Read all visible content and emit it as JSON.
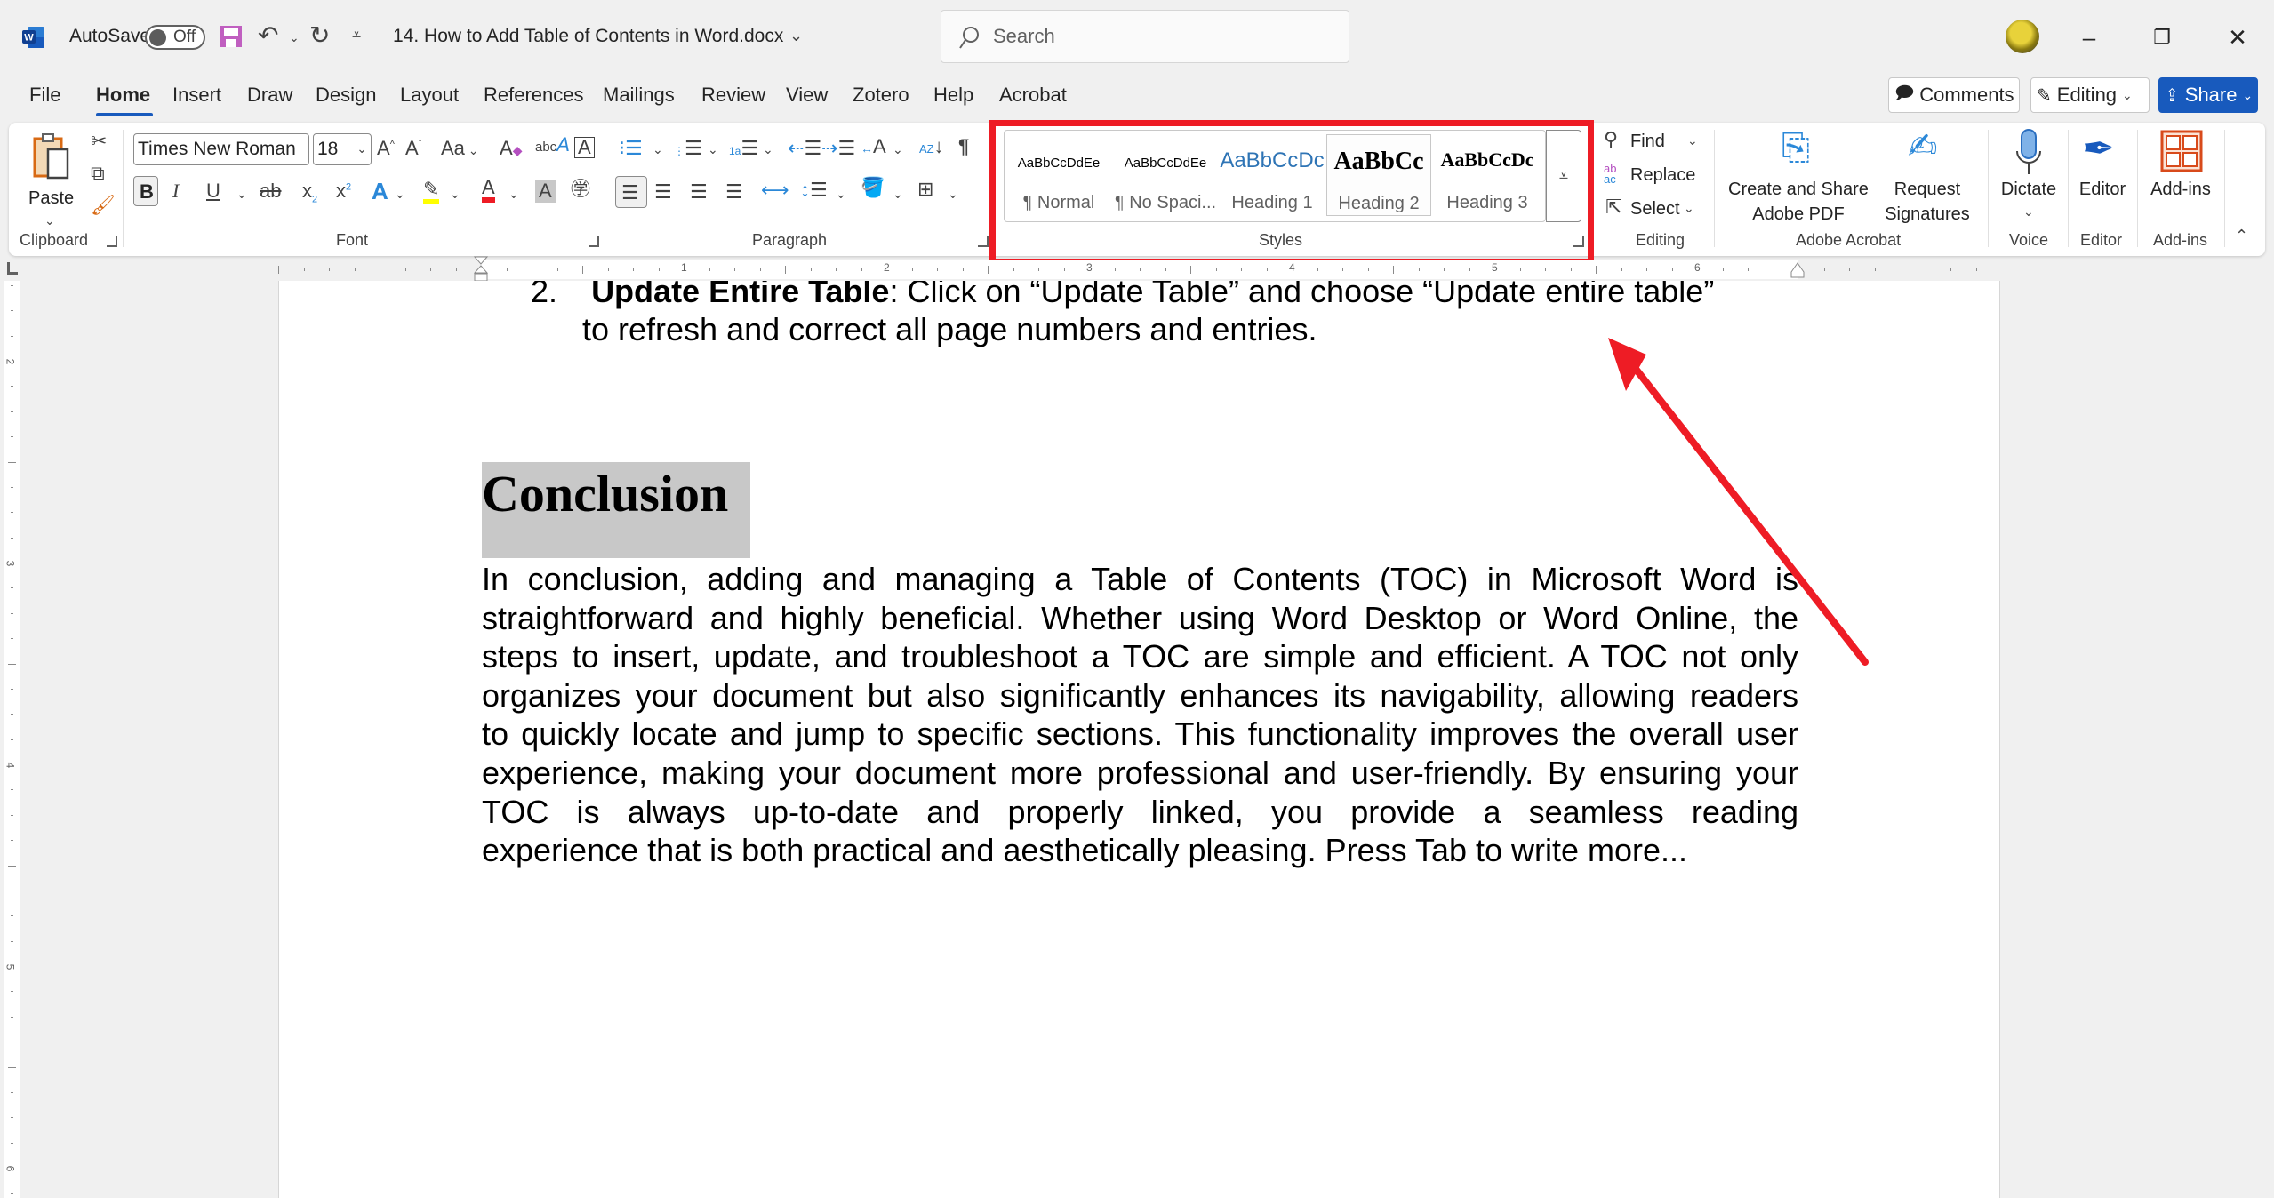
{
  "titlebar": {
    "app_icon": "word-logo-icon",
    "autosave_label": "AutoSave",
    "autosave_state": "Off",
    "document_title": "14. How to Add Table of Contents in Word.docx",
    "search_placeholder": "Search",
    "window_controls": [
      "minimize",
      "restore",
      "close"
    ]
  },
  "tabs": [
    {
      "label": "File"
    },
    {
      "label": "Home",
      "active": true
    },
    {
      "label": "Insert"
    },
    {
      "label": "Draw"
    },
    {
      "label": "Design"
    },
    {
      "label": "Layout"
    },
    {
      "label": "References"
    },
    {
      "label": "Mailings"
    },
    {
      "label": "Review"
    },
    {
      "label": "View"
    },
    {
      "label": "Zotero"
    },
    {
      "label": "Help"
    },
    {
      "label": "Acrobat"
    }
  ],
  "header_buttons": {
    "comments": "Comments",
    "editing": "Editing",
    "share": "Share"
  },
  "ribbon": {
    "clipboard": {
      "label": "Clipboard",
      "paste": "Paste"
    },
    "font": {
      "label": "Font",
      "font_name": "Times New Roman",
      "font_size": "18"
    },
    "paragraph": {
      "label": "Paragraph"
    },
    "styles": {
      "label": "Styles",
      "items": [
        {
          "preview": "AaBbCcDdEe",
          "name": "¶ Normal"
        },
        {
          "preview": "AaBbCcDdEe",
          "name": "¶ No Spaci..."
        },
        {
          "preview": "AaBbCcDc",
          "name": "Heading 1"
        },
        {
          "preview": "AaBbCc",
          "name": "Heading 2",
          "selected": true
        },
        {
          "preview": "AaBbCcDc",
          "name": "Heading 3"
        }
      ]
    },
    "editing": {
      "label": "Editing",
      "find": "Find",
      "replace": "Replace",
      "select": "Select"
    },
    "adobe": {
      "label": "Adobe Acrobat",
      "create_line1": "Create and Share",
      "create_line2": "Adobe PDF",
      "request_line1": "Request",
      "request_line2": "Signatures"
    },
    "voice": {
      "label": "Voice",
      "dictate": "Dictate"
    },
    "editor": {
      "label": "Editor",
      "editor": "Editor"
    },
    "addins": {
      "label": "Add-ins",
      "addins": "Add-ins"
    }
  },
  "ruler": {
    "numbers": [
      "1",
      "2",
      "3",
      "4",
      "5",
      "6"
    ],
    "vertical_numbers": [
      "2",
      "3",
      "4",
      "5",
      "6"
    ]
  },
  "document": {
    "list_item": {
      "number": "2.",
      "bold": "Update Entire Table",
      "rest_line1": ": Click on “Update Table” and choose “Update entire table”",
      "line2": "to refresh and correct all page numbers and entries."
    },
    "heading": "Conclusion",
    "paragraph_lines": [
      "In conclusion, adding and managing a Table of Contents (TOC) in Microsoft Word is",
      "straightforward and highly beneficial. Whether using Word Desktop or Word Online, the",
      "steps to insert, update, and troubleshoot a TOC are simple and efficient. A TOC not only",
      "organizes your document but also significantly enhances its navigability, allowing readers",
      "to quickly locate and jump to specific sections. This functionality improves the overall user",
      "experience, making your document more professional and user-friendly. By ensuring your",
      "TOC is always up-to-date and properly linked, you provide a seamless reading",
      "experience that is both practical and aesthetically pleasing. Press Tab to write more..."
    ]
  },
  "annotation": {
    "highlight_color": "#ee1c25",
    "target": "Styles group"
  },
  "colors": {
    "accent": "#185abd",
    "highlight_box": "#ee1c25",
    "heading_shading": "#c8c8c8"
  }
}
